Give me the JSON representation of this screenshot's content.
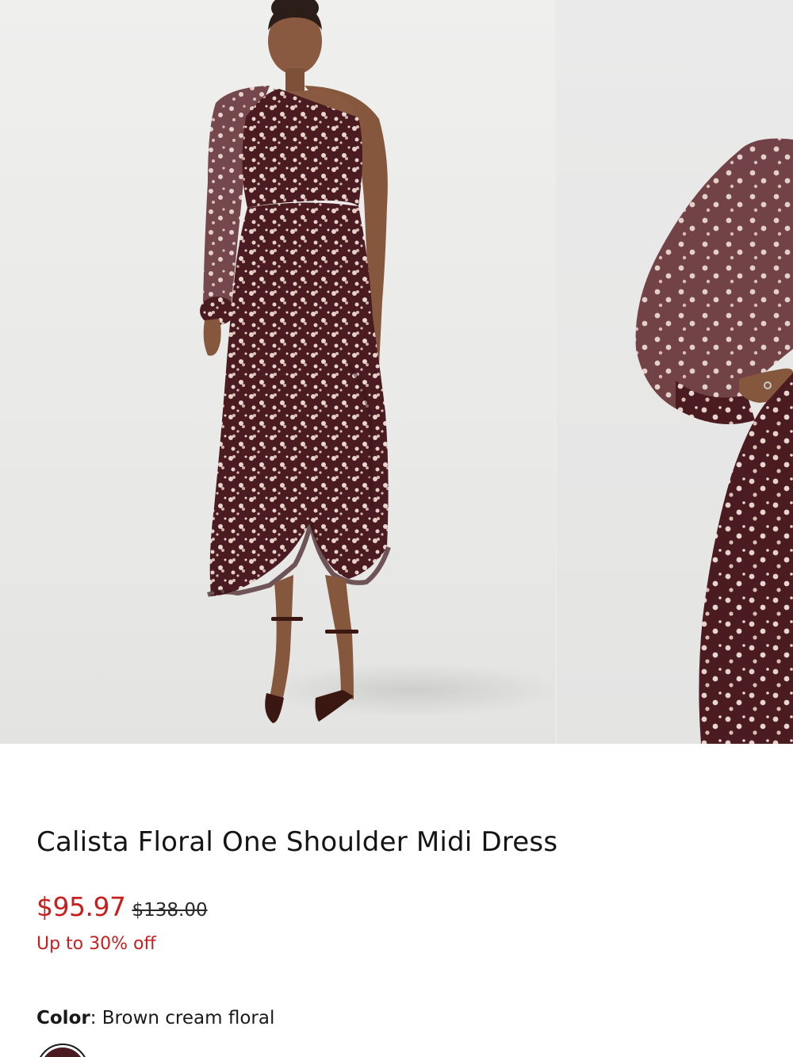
{
  "product": {
    "title": "Calista Floral One Shoulder Midi Dress",
    "price_sale": "$95.97",
    "price_original": "$138.00",
    "discount": "Up to 30% off",
    "color_label": "Color",
    "color_value": "Brown cream floral"
  },
  "icons": {
    "swatch": "brown-cream-floral-swatch"
  },
  "colors": {
    "sale_red": "#c81e1e",
    "dress_brown": "#4a1c22",
    "floral_cream": "#e8d6cf"
  }
}
